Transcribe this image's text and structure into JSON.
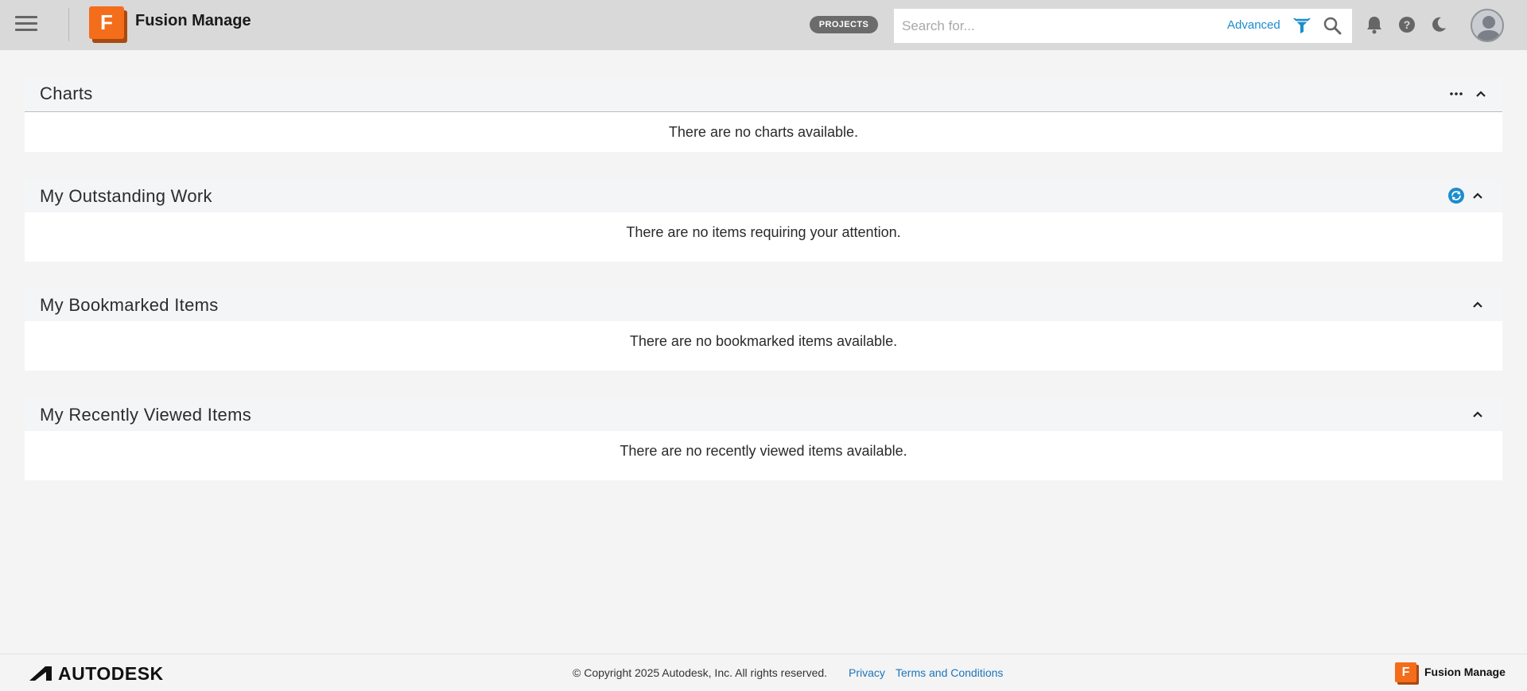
{
  "header": {
    "app_title": "Fusion Manage",
    "logo_letter": "F",
    "projects_label": "PROJECTS",
    "search_placeholder": "Search for...",
    "advanced_label": "Advanced",
    "icons": [
      "menu-icon",
      "filter-icon",
      "search-icon",
      "bell-icon",
      "help-icon",
      "moon-icon",
      "avatar"
    ]
  },
  "sections": {
    "charts": {
      "title": "Charts",
      "empty": "There are no charts available."
    },
    "outstanding": {
      "title": "My Outstanding Work",
      "empty": "There are no items requiring your attention."
    },
    "bookmarked": {
      "title": "My Bookmarked Items",
      "empty": "There are no bookmarked items available."
    },
    "recent": {
      "title": "My Recently Viewed Items",
      "empty": "There are no recently viewed items available."
    }
  },
  "footer": {
    "brand": "AUTODESK",
    "copyright": "© Copyright 2025 Autodesk, Inc. All rights reserved.",
    "privacy": "Privacy",
    "terms": "Terms and Conditions",
    "app_name": "Fusion Manage",
    "logo_letter": "F"
  },
  "colors": {
    "accent": "#1b8ccf",
    "brand_orange": "#f46d1b",
    "header_bg": "#d9d9d9",
    "page_bg": "#f4f4f4"
  }
}
